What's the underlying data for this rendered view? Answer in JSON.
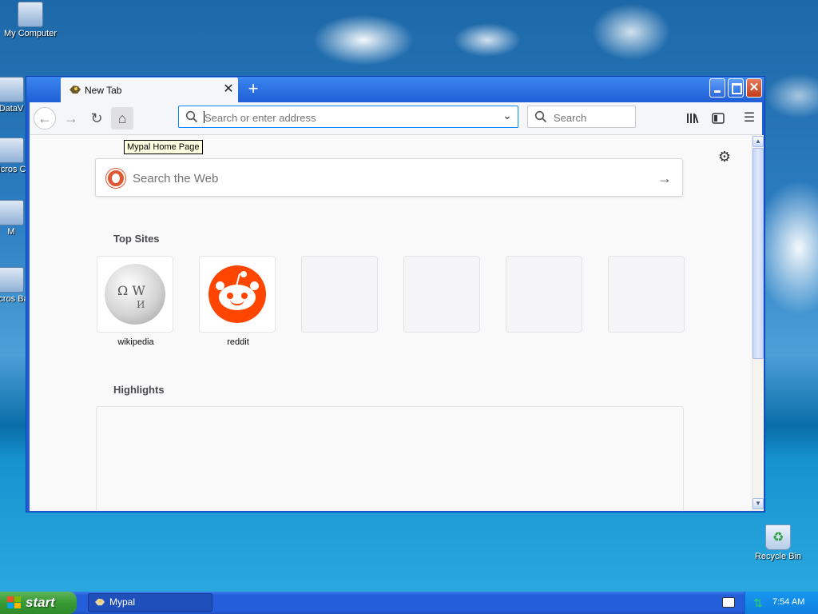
{
  "desktop": {
    "icons": [
      {
        "label": "My Computer",
        "icon": "computer-icon"
      },
      {
        "label": "DataV",
        "icon": "app-icon"
      },
      {
        "label": "Micros C+",
        "icon": "app-icon"
      },
      {
        "label": "M",
        "icon": "app-icon"
      },
      {
        "label": "Micros Bas",
        "icon": "app-icon"
      },
      {
        "label": "Recycle Bin",
        "icon": "recycle-bin-icon"
      }
    ]
  },
  "browser": {
    "tab": {
      "title": "New Tab",
      "favicon": "mypal-icon",
      "close_glyph": "✕"
    },
    "new_tab_glyph": "+",
    "window_controls": {
      "minimize": "",
      "maximize": "",
      "close": "✕"
    },
    "nav": {
      "back": "←",
      "forward": "→",
      "reload": "↻",
      "home": "⌂"
    },
    "tooltip": "Mypal Home Page",
    "url_bar": {
      "placeholder": "Search or enter address",
      "value": "",
      "dropdown_glyph": "⌄"
    },
    "search_bar": {
      "placeholder": "Search"
    },
    "toolbar": {
      "library": "|||\\",
      "sidebar": "◫",
      "menu": "☰"
    }
  },
  "newtab": {
    "settings_glyph": "⚙",
    "web_search": {
      "placeholder": "Search the Web",
      "submit_glyph": "→",
      "engine_icon": "duckduckgo-icon"
    },
    "top_sites_title": "Top Sites",
    "top_sites": [
      {
        "label": "wikipedia",
        "icon": "wikipedia-icon"
      },
      {
        "label": "reddit",
        "icon": "reddit-icon"
      },
      {
        "label": "",
        "icon": ""
      },
      {
        "label": "",
        "icon": ""
      },
      {
        "label": "",
        "icon": ""
      },
      {
        "label": "",
        "icon": ""
      }
    ],
    "highlights_title": "Highlights"
  },
  "scrollbar": {
    "up": "▲",
    "down": "▼"
  },
  "taskbar": {
    "start_label": "start",
    "task_label": "Mypal",
    "clock": "7:54 AM"
  },
  "colors": {
    "accent": "#0a84ff",
    "titlebar": "#1f5fd6",
    "taskbar": "#245edb",
    "start_green": "#379a33",
    "reddit": "#ff4500",
    "duckduckgo": "#de5833"
  }
}
